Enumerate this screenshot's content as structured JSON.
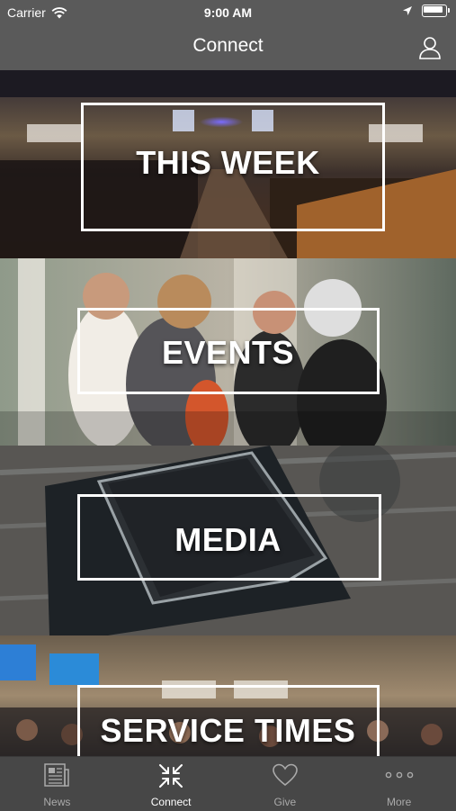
{
  "status_bar": {
    "carrier": "Carrier",
    "time": "9:00 AM"
  },
  "navbar": {
    "title": "Connect"
  },
  "tiles": [
    {
      "label": "THIS WEEK"
    },
    {
      "label": "EVENTS"
    },
    {
      "label": "MEDIA"
    },
    {
      "label": "SERVICE TIMES"
    }
  ],
  "tabbar": {
    "items": [
      {
        "label": "News",
        "icon": "newspaper-icon"
      },
      {
        "label": "Connect",
        "icon": "connect-arrows-icon",
        "active": true
      },
      {
        "label": "Give",
        "icon": "heart-icon"
      },
      {
        "label": "More",
        "icon": "more-dots-icon"
      }
    ]
  },
  "colors": {
    "bar_bg": "#5a5a5a",
    "tabbar_bg": "#474747",
    "active": "#ffffff",
    "inactive": "#aaaaaa"
  }
}
